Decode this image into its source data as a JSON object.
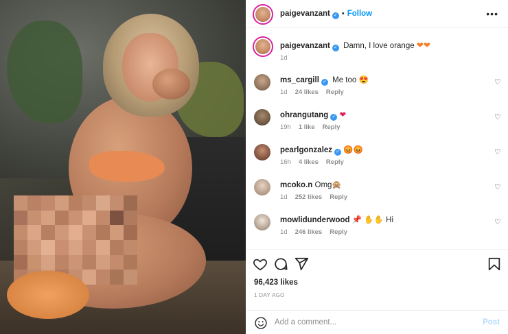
{
  "post_author": {
    "username": "paigevanzant",
    "follow_label": "Follow",
    "separator": "•"
  },
  "caption": {
    "username": "paigevanzant",
    "text": "Damn, I love orange",
    "time": "1d"
  },
  "comments": [
    {
      "username": "ms_cargill",
      "text": "Me too",
      "emoji": "😍",
      "time": "1d",
      "likes": "24 likes",
      "reply": "Reply"
    },
    {
      "username": "ohrangutang",
      "text": "",
      "emoji": "❤",
      "time": "19h",
      "likes": "1 like",
      "reply": "Reply"
    },
    {
      "username": "pearlgonzalez",
      "text": "",
      "emoji": "😡😡",
      "time": "16h",
      "likes": "4 likes",
      "reply": "Reply"
    },
    {
      "username": "mcoko.n",
      "text": "Omg",
      "emoji": "🙊",
      "time": "1d",
      "likes": "252 likes",
      "reply": "Reply"
    },
    {
      "username": "mowlidunderwood",
      "text": "Hi",
      "emoji": "📌 ✋✋",
      "time": "1d",
      "likes": "246 likes",
      "reply": "Reply"
    }
  ],
  "engagement": {
    "likes": "96,423 likes",
    "time_ago": "1 DAY AGO"
  },
  "comment_box": {
    "placeholder": "Add a comment...",
    "post_label": "Post"
  },
  "icons": {
    "heart": "heart-icon",
    "comment": "comment-icon",
    "share": "share-icon",
    "save": "bookmark-icon",
    "more": "more-options-icon",
    "emoji": "emoji-icon"
  },
  "colors": {
    "link_blue": "#0095f6",
    "verified_blue": "#3897f0",
    "meta_gray": "#8e8e8e",
    "post_disabled": "#b3dbff",
    "orange_heart": "#f77f2a"
  }
}
